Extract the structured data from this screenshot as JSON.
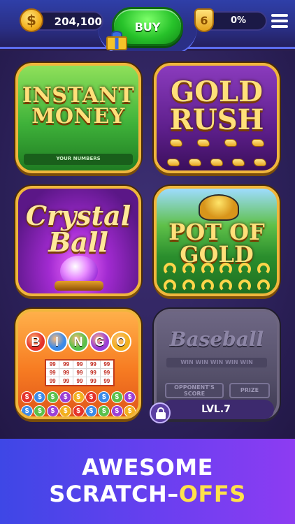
{
  "header": {
    "coins": "204,100",
    "coin_symbol": "$",
    "buy_label": "BUY",
    "level_number": "6",
    "level_progress_percent": 0,
    "level_progress_label": "0%"
  },
  "games": [
    {
      "title": "INSTANT MONEY",
      "subtitle": "YOUR NUMBERS",
      "locked": false
    },
    {
      "title": "GOLD RUSH",
      "locked": false
    },
    {
      "title": "Crystal Ball",
      "locked": false
    },
    {
      "title": "POT OF GOLD",
      "locked": false
    },
    {
      "title": "BINGO",
      "balls": [
        "B",
        "I",
        "N",
        "G",
        "O"
      ],
      "ball_colors": [
        "#e5332a",
        "#3c8be8",
        "#5bc04a",
        "#9b3fd6",
        "#f2b01e"
      ],
      "cell_value": "99",
      "locked": false
    },
    {
      "title": "Baseball",
      "strip": "WIN WIN WIN WIN WIN",
      "opponent_label": "OPPONENT'S SCORE",
      "prize_label": "PRIZE",
      "locked": true,
      "lock_label": "LVL.7"
    }
  ],
  "banner": {
    "line1": "AWESOME",
    "line2_prefix": "SCRATCH–",
    "line2_accent": "OFFS"
  },
  "colors": {
    "accent_yellow": "#ffe24a",
    "buy_green": "#27c22a",
    "banner_blue": "#3e47e6",
    "banner_purple": "#8d3cf2"
  }
}
